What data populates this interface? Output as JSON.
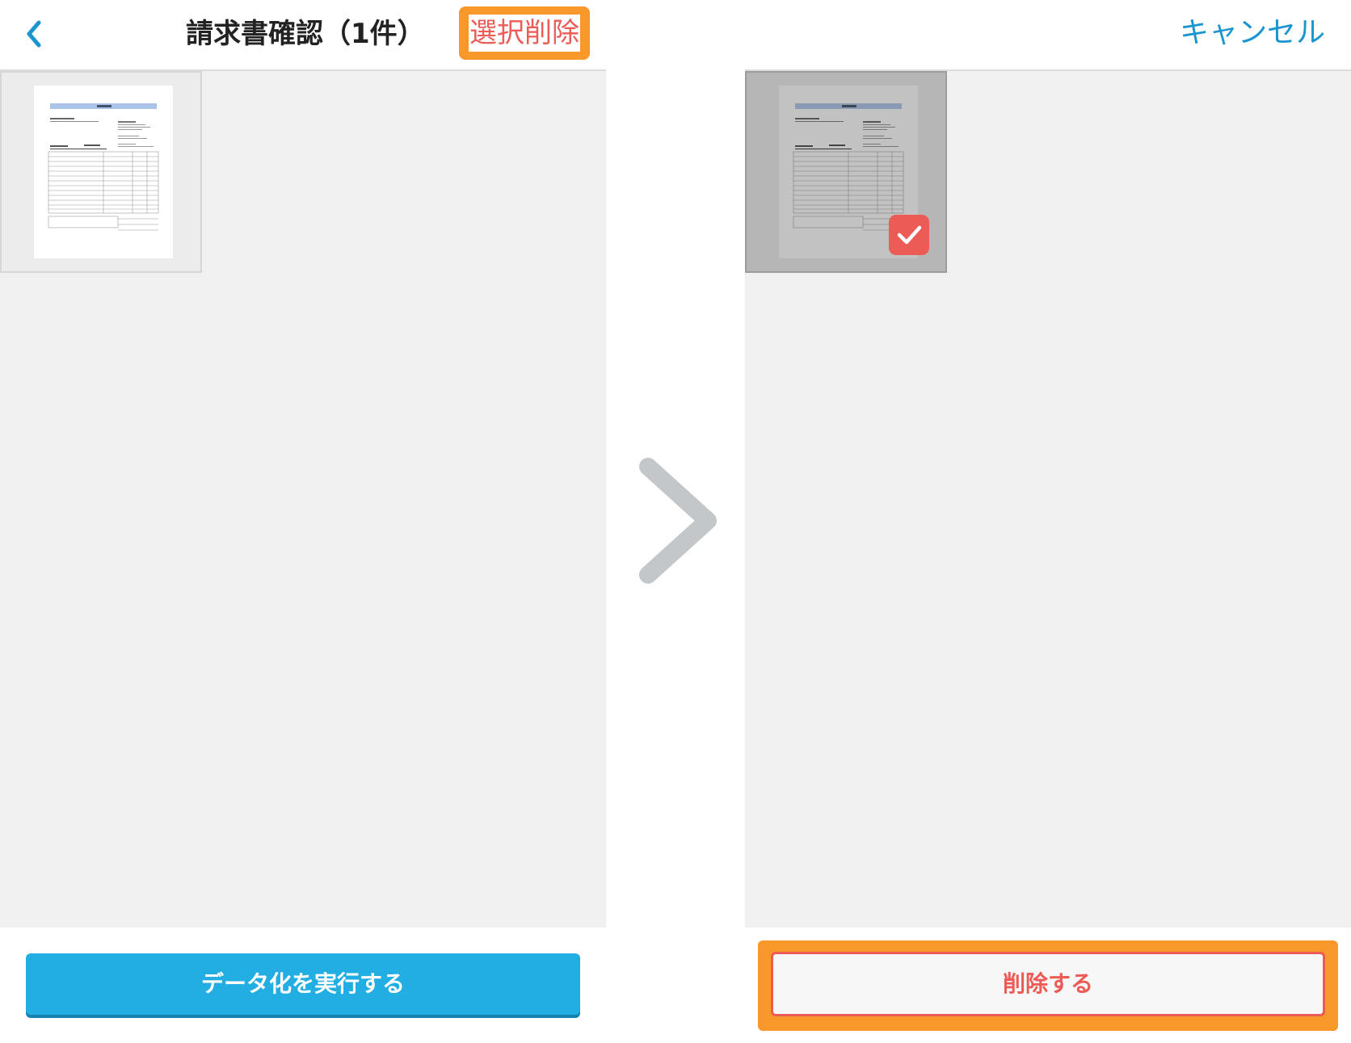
{
  "left_screen": {
    "title": "請求書確認（1件）",
    "select_delete_label": "選択削除",
    "primary_button_label": "データ化を実行する"
  },
  "right_screen": {
    "cancel_label": "キャンセル",
    "delete_button_label": "削除する",
    "selected_count": 1
  },
  "documents": [
    {
      "selected_on_right": true
    }
  ],
  "colors": {
    "accent_blue": "#22ade3",
    "link_blue": "#1a95cf",
    "delete_red": "#ec5b56",
    "highlight_orange": "#f8972a",
    "arrow_gray": "#c3c7c9"
  },
  "icons": {
    "back": "chevron-left-icon",
    "check": "checkmark-icon",
    "transition": "chevron-right-icon"
  }
}
